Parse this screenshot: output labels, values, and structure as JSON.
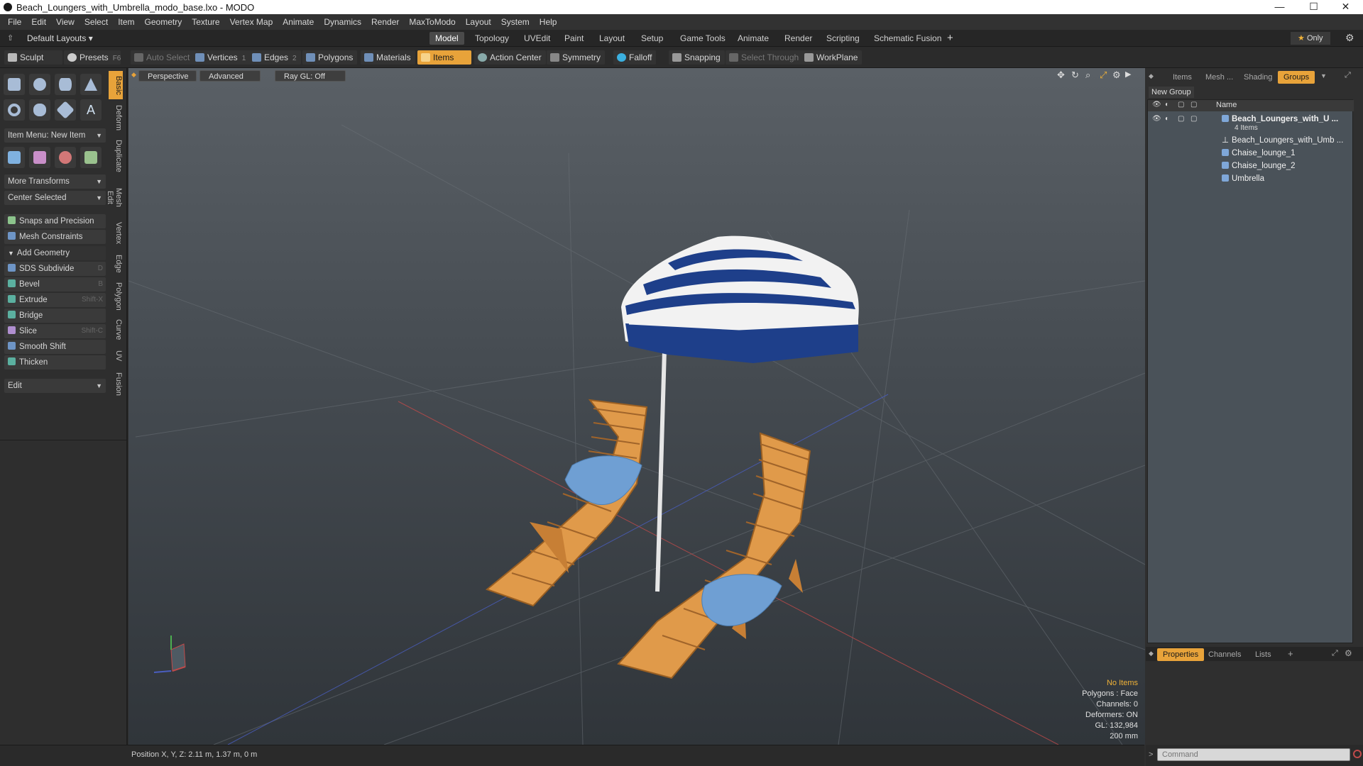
{
  "window": {
    "title": "Beach_Loungers_with_Umbrella_modo_base.lxo - MODO"
  },
  "menu": [
    "File",
    "Edit",
    "View",
    "Select",
    "Item",
    "Geometry",
    "Texture",
    "Vertex Map",
    "Animate",
    "Dynamics",
    "Render",
    "MaxToModo",
    "Layout",
    "System",
    "Help"
  ],
  "layoutbar": {
    "layout_select": "Default Layouts",
    "tabs": [
      "Model",
      "Topology",
      "UVEdit",
      "Paint",
      "Layout",
      "Setup",
      "Game Tools",
      "Animate",
      "Render",
      "Scripting",
      "Schematic Fusion"
    ],
    "active_tab": "Model",
    "only_label": "Only"
  },
  "toolbar": {
    "sculpt": "Sculpt",
    "presets": "Presets",
    "presets_key": "F6",
    "auto_select": "Auto Select",
    "vertices": "Vertices",
    "vertices_count": "1",
    "edges": "Edges",
    "edges_count": "2",
    "polygons": "Polygons",
    "materials": "Materials",
    "items": "Items",
    "action_center": "Action Center",
    "symmetry": "Symmetry",
    "falloff": "Falloff",
    "snapping": "Snapping",
    "select_through": "Select Through",
    "workplane": "WorkPlane"
  },
  "leftpanel": {
    "item_menu": "Item Menu: New Item",
    "more_transforms": "More Transforms",
    "center_selected": "Center Selected",
    "snaps": "Snaps and Precision",
    "mesh_constraints": "Mesh Constraints",
    "add_geometry": "Add Geometry",
    "tools": [
      {
        "label": "SDS Subdivide",
        "key": "D"
      },
      {
        "label": "Bevel",
        "key": "B"
      },
      {
        "label": "Extrude",
        "key": "Shift-X"
      },
      {
        "label": "Bridge",
        "key": ""
      },
      {
        "label": "Slice",
        "key": "Shift-C"
      },
      {
        "label": "Smooth Shift",
        "key": ""
      },
      {
        "label": "Thicken",
        "key": ""
      }
    ],
    "edit": "Edit",
    "vtabs": [
      "Basic",
      "Deform",
      "Duplicate",
      "Mesh Edit",
      "Vertex",
      "Edge",
      "Polygon",
      "Curve",
      "UV",
      "Fusion"
    ]
  },
  "viewport": {
    "view": "Perspective",
    "advanced": "Advanced",
    "raygl": "Ray GL: Off",
    "info": {
      "no_items": "No Items",
      "polygons": "Polygons : Face",
      "channels": "Channels: 0",
      "deformers": "Deformers: ON",
      "gl": "GL: 132,984",
      "scale": "200 mm"
    }
  },
  "status": {
    "position": "Position X, Y, Z:  2.11 m, 1.37 m, 0 m"
  },
  "rightpanel": {
    "tabs": [
      "Items",
      "Mesh ...",
      "Shading",
      "Groups"
    ],
    "active_tab": "Groups",
    "new_group": "New Group",
    "name_col": "Name",
    "tree": {
      "root": "Beach_Loungers_with_U ...",
      "root_sub": "4 Items",
      "children": [
        "Beach_Loungers_with_Umb ...",
        "Chaise_lounge_1",
        "Chaise_lounge_2",
        "Umbrella"
      ]
    },
    "bottom_tabs": [
      "Properties",
      "Channels",
      "Lists"
    ],
    "command_placeholder": "Command"
  },
  "colors": {
    "accent": "#e8a33a",
    "wood": "#e09a4a",
    "cushion": "#6f9fd3",
    "stripe": "#1e3f8a"
  }
}
